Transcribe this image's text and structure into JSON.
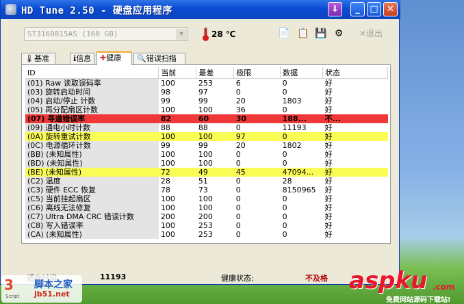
{
  "window": {
    "title": "HD Tune 2.50 - 硬盘应用程序",
    "buttons": {
      "down": "⇓",
      "minimize": "_",
      "maximize": "□",
      "close": "✕"
    }
  },
  "toolbar": {
    "drive": "ST3160815AS (160 GB)",
    "temperature": "28 ℃",
    "exit_label": "✕退出",
    "icons": [
      "copy-icon",
      "copy-info-icon",
      "save-icon",
      "options-icon"
    ]
  },
  "tabs": [
    {
      "label": "基准",
      "icon": "benchmark-icon"
    },
    {
      "label": "信息",
      "icon": "info-icon"
    },
    {
      "label": "健康",
      "icon": "health-icon"
    },
    {
      "label": "错误扫描",
      "icon": "scan-icon"
    }
  ],
  "active_tab": 2,
  "columns": [
    "ID",
    "当前",
    "最差",
    "极限",
    "数据",
    "状态"
  ],
  "rows": [
    {
      "id": "(01) Raw 读取误码率",
      "cur": "100",
      "worst": "253",
      "thr": "6",
      "data": "0",
      "status": "好",
      "hl": ""
    },
    {
      "id": "(03) 旋转启动时间",
      "cur": "98",
      "worst": "97",
      "thr": "0",
      "data": "0",
      "status": "好",
      "hl": ""
    },
    {
      "id": "(04) 启动/停止 计数",
      "cur": "99",
      "worst": "99",
      "thr": "20",
      "data": "1803",
      "status": "好",
      "hl": ""
    },
    {
      "id": "(05) 再分配扇区计数",
      "cur": "100",
      "worst": "100",
      "thr": "36",
      "data": "0",
      "status": "好",
      "hl": ""
    },
    {
      "id": "(07) 寻道错误率",
      "cur": "82",
      "worst": "60",
      "thr": "30",
      "data": "188...",
      "status": "不...",
      "hl": "red"
    },
    {
      "id": "(09) 通电小时计数",
      "cur": "88",
      "worst": "88",
      "thr": "0",
      "data": "11193",
      "status": "好",
      "hl": ""
    },
    {
      "id": "(0A) 旋转重试计数",
      "cur": "100",
      "worst": "100",
      "thr": "97",
      "data": "0",
      "status": "好",
      "hl": "yellow"
    },
    {
      "id": "(0C) 电源循环计数",
      "cur": "99",
      "worst": "99",
      "thr": "20",
      "data": "1802",
      "status": "好",
      "hl": ""
    },
    {
      "id": "(BB) (未知属性)",
      "cur": "100",
      "worst": "100",
      "thr": "0",
      "data": "0",
      "status": "好",
      "hl": ""
    },
    {
      "id": "(BD) (未知属性)",
      "cur": "100",
      "worst": "100",
      "thr": "0",
      "data": "0",
      "status": "好",
      "hl": ""
    },
    {
      "id": "(BE) (未知属性)",
      "cur": "72",
      "worst": "49",
      "thr": "45",
      "data": "47094...",
      "status": "好",
      "hl": "yellow"
    },
    {
      "id": "(C2) 温度",
      "cur": "28",
      "worst": "51",
      "thr": "0",
      "data": "28",
      "status": "好",
      "hl": ""
    },
    {
      "id": "(C3) 硬件 ECC 恢复",
      "cur": "78",
      "worst": "73",
      "thr": "0",
      "data": "8150965",
      "status": "好",
      "hl": ""
    },
    {
      "id": "(C5) 当前挂起扇区",
      "cur": "100",
      "worst": "100",
      "thr": "0",
      "data": "0",
      "status": "好",
      "hl": ""
    },
    {
      "id": "(C6) 离线无法修复",
      "cur": "100",
      "worst": "100",
      "thr": "0",
      "data": "0",
      "status": "好",
      "hl": ""
    },
    {
      "id": "(C7) Ultra DMA CRC 错误计数",
      "cur": "200",
      "worst": "200",
      "thr": "0",
      "data": "0",
      "status": "好",
      "hl": ""
    },
    {
      "id": "(C8) 写入错误率",
      "cur": "100",
      "worst": "253",
      "thr": "0",
      "data": "0",
      "status": "好",
      "hl": ""
    },
    {
      "id": "(CA) (未知属性)",
      "cur": "100",
      "worst": "253",
      "thr": "0",
      "data": "0",
      "status": "好",
      "hl": ""
    }
  ],
  "status": {
    "power_label": "通电时间",
    "power_value": "11193",
    "health_label": "健康状态:",
    "health_value": "不及格"
  },
  "watermark_left": {
    "logo": "3",
    "name": "脚本之家",
    "url": "jb51.net",
    "sub": "Script"
  },
  "watermark_right": {
    "brand": "aspku",
    "suffix": ".com",
    "tagline": "免费网站源码下载站!"
  }
}
